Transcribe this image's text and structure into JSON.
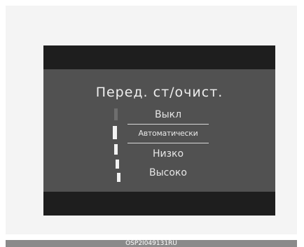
{
  "screen": {
    "title": "Перед. ст/очист.",
    "items": [
      {
        "label": "Выкл"
      },
      {
        "label": "Автоматически",
        "selected": true
      },
      {
        "label": "Низко"
      },
      {
        "label": "Высоко"
      }
    ]
  },
  "caption": "OSP2I049131RU"
}
